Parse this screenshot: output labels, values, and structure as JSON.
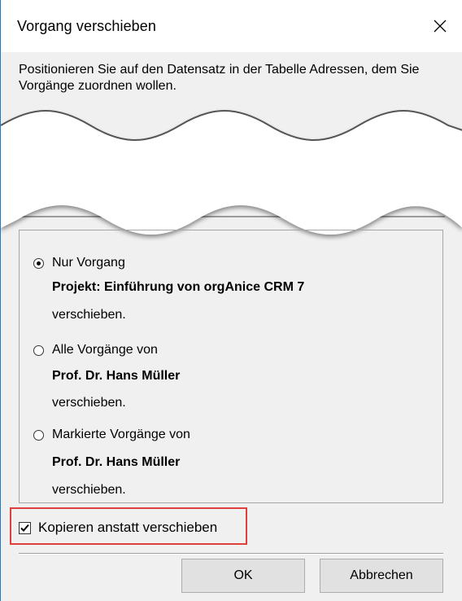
{
  "dialog": {
    "title": "Vorgang verschieben",
    "close_icon": "close-icon"
  },
  "intro_text": "Positionieren Sie auf den Datensatz in der Tabelle Adressen, dem Sie Vorgänge zuordnen wollen.",
  "options": [
    {
      "label": "Nur Vorgang",
      "checked": true,
      "detail": "Projekt: Einführung von orgAnice CRM 7",
      "suffix": "verschieben."
    },
    {
      "label": "Alle Vorgänge von",
      "checked": false,
      "detail": "Prof. Dr. Hans Müller",
      "suffix": "verschieben."
    },
    {
      "label": "Markierte Vorgänge von",
      "checked": false,
      "detail": "Prof. Dr. Hans Müller",
      "suffix": "verschieben."
    }
  ],
  "copy_checkbox": {
    "label": "Kopieren anstatt verschieben",
    "checked": true,
    "highlight_color": "#e0403c"
  },
  "buttons": {
    "ok": "OK",
    "cancel": "Abbrechen"
  },
  "colors": {
    "window_border": "#1e78c8",
    "dialog_bg": "#f0f0f0",
    "button_bg": "#e1e1e1"
  }
}
